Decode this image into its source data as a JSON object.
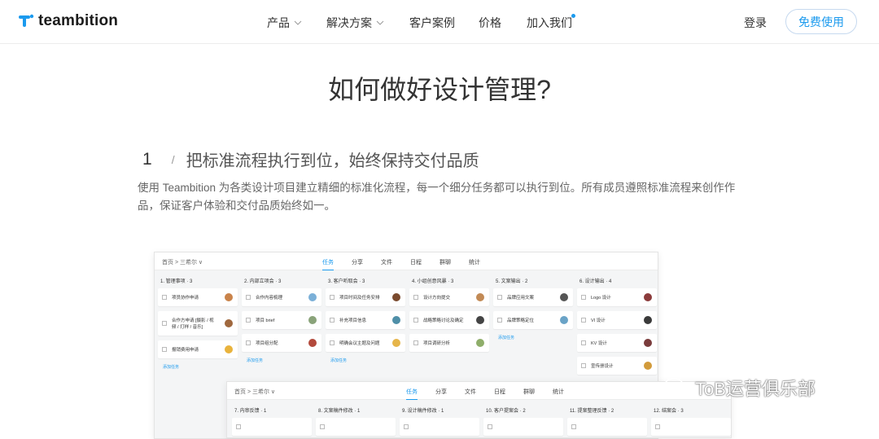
{
  "nav": {
    "logo_text": "teambition",
    "menu": [
      {
        "label": "产品",
        "chevron": true
      },
      {
        "label": "解决方案",
        "chevron": true
      },
      {
        "label": "客户案例",
        "chevron": false
      },
      {
        "label": "价格",
        "chevron": false
      },
      {
        "label": "加入我们",
        "chevron": false,
        "dot": true
      }
    ],
    "login": "登录",
    "free": "免费使用",
    "accent": "#1b9aee"
  },
  "page_title": "如何做好设计管理?",
  "step": {
    "number": "1",
    "slash": "/",
    "text": "把标准流程执行到位，始终保持交付品质"
  },
  "description": "使用 Teambition 为各类设计项目建立精细的标准化流程，每一个细分任务都可以执行到位。所有成员遵照标准流程来创作作品，保证客户体验和交付品质始终如一。",
  "screenshot1": {
    "crumb": "首页 > 三希尔 ∨",
    "tabs": [
      "任务",
      "分享",
      "文件",
      "日程",
      "群聊",
      "统计"
    ],
    "columns": [
      {
        "head": "1. 管理事项 · 3",
        "cards": [
          "项员协作申请",
          "合作方申请 [摄影 / 视频 / 打样 / 音乐]",
          "报销费用申请"
        ]
      },
      {
        "head": "2. 内部立项会 · 3",
        "cards": [
          "合作内容梳理",
          "项目 brief",
          "项目组分配"
        ]
      },
      {
        "head": "3. 客户听取会 · 3",
        "cards": [
          "项目时间及任务安排",
          "补充项目信息",
          "明确会议主题及问题"
        ]
      },
      {
        "head": "4. 小组创意风暴 · 3",
        "cards": [
          "设计方向提交",
          "战略策略讨论及确定",
          "项目调研分析"
        ]
      },
      {
        "head": "5. 文案输出 · 2",
        "cards": [
          "品牌应用文案",
          "品牌策略定位"
        ]
      },
      {
        "head": "6. 设计输出 · 4",
        "cards": [
          "Logo 设计",
          "VI 设计",
          "KV 设计",
          "宣传册设计"
        ]
      }
    ],
    "add_task": "添加任务"
  },
  "screenshot2": {
    "crumb": "首页 > 三希尔 ∨",
    "tabs": [
      "任务",
      "分享",
      "文件",
      "日程",
      "群聊",
      "统计"
    ],
    "columns": [
      {
        "head": "7. 内审反馈 · 1"
      },
      {
        "head": "8. 文案稿件修改 · 1"
      },
      {
        "head": "9. 设计稿件修改 · 1"
      },
      {
        "head": "10. 客户提案会 · 2"
      },
      {
        "head": "11. 提案整理反馈 · 2"
      },
      {
        "head": "12. 结案会 · 3"
      }
    ]
  },
  "watermark": "ToB运营俱乐部"
}
